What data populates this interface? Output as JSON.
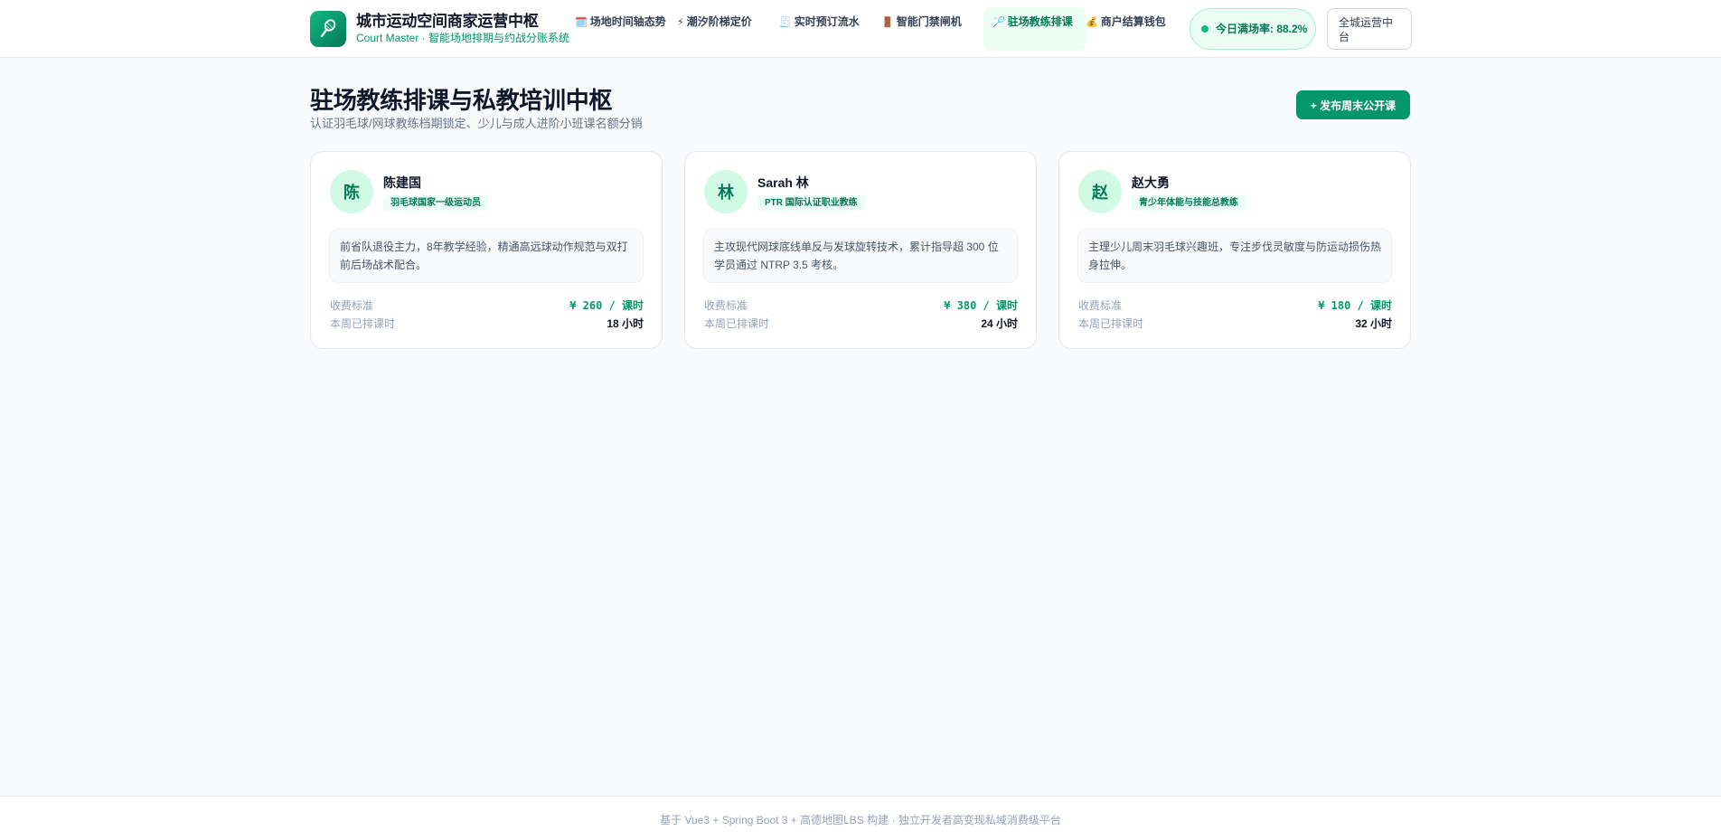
{
  "header": {
    "logo_icon": "badminton-racket-icon",
    "title": "城市运动空间商家运营中枢",
    "subtitle_prefix": "Court Master · ",
    "subtitle_highlight": "智能场地排期与约战分账系统",
    "nav": [
      {
        "icon": "🗓️",
        "icon_name": "calendar-icon",
        "label": "场地时间轴态势"
      },
      {
        "icon": "⚡",
        "icon_name": "lightning-icon",
        "label": "潮汐阶梯定价"
      },
      {
        "icon": "🧾",
        "icon_name": "receipt-icon",
        "label": "实时预订流水"
      },
      {
        "icon": "🚪",
        "icon_name": "door-icon",
        "label": "智能门禁闸机"
      },
      {
        "icon": "🏸",
        "icon_name": "badminton-icon",
        "label": "驻场教练排课"
      },
      {
        "icon": "💰",
        "icon_name": "money-bag-icon",
        "label": "商户结算钱包"
      }
    ],
    "fill_rate": "今日满场率: 88.2%",
    "ops_button": "全城运营中台"
  },
  "page": {
    "title": "驻场教练排课与私教培训中枢",
    "subtitle": "认证羽毛球/网球教练档期锁定、少儿与成人进阶小班课名额分销",
    "publish_button": "+ 发布周末公开课"
  },
  "coaches": [
    {
      "avatar": "陈",
      "name": "陈建国",
      "badge": "羽毛球国家一级运动员",
      "desc": "前省队退役主力，8年教学经验，精通高远球动作规范与双打前后场战术配合。",
      "fee_label": "收费标准",
      "fee": "¥ 260 / 课时",
      "hours_label": "本周已排课时",
      "hours": "18 小时"
    },
    {
      "avatar": "林",
      "name": "Sarah 林",
      "badge": "PTR 国际认证职业教练",
      "desc": "主攻现代网球底线单反与发球旋转技术，累计指导超 300 位学员通过 NTRP 3.5 考核。",
      "fee_label": "收费标准",
      "fee": "¥ 380 / 课时",
      "hours_label": "本周已排课时",
      "hours": "24 小时"
    },
    {
      "avatar": "赵",
      "name": "赵大勇",
      "badge": "青少年体能与技能总教练",
      "desc": "主理少儿周末羽毛球兴趣班，专注步伐灵敏度与防运动损伤热身拉伸。",
      "fee_label": "收费标准",
      "fee": "¥ 180 / 课时",
      "hours_label": "本周已排课时",
      "hours": "32 小时"
    }
  ],
  "footer": {
    "text": "基于 Vue3 + Spring Boot 3 + 高德地图LBS 构建 · 独立开发者高变现私域消费级平台"
  },
  "colors": {
    "accent": "#059669",
    "accent_light": "#ecfdf5",
    "background": "#f8fafc"
  }
}
